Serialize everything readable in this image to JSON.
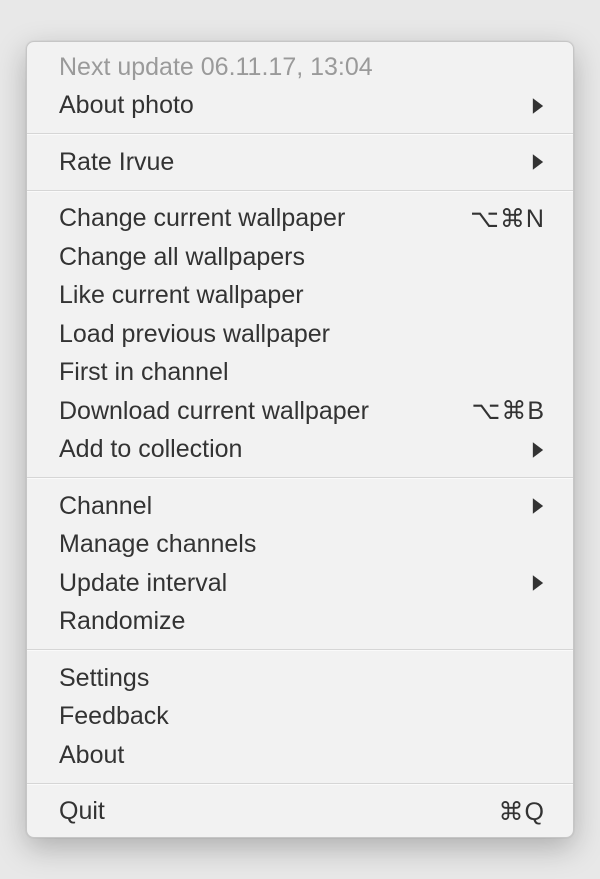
{
  "menu": {
    "next_update": "Next update 06.11.17, 13:04",
    "about_photo": "About photo",
    "rate_irvue": "Rate Irvue",
    "change_current": "Change current wallpaper",
    "change_current_shortcut": "⌥⌘N",
    "change_all": "Change all wallpapers",
    "like_current": "Like current wallpaper",
    "load_previous": "Load previous wallpaper",
    "first_in_channel": "First in channel",
    "download_current": "Download current wallpaper",
    "download_current_shortcut": "⌥⌘B",
    "add_to_collection": "Add to collection",
    "channel": "Channel",
    "manage_channels": "Manage channels",
    "update_interval": "Update interval",
    "randomize": "Randomize",
    "settings": "Settings",
    "feedback": "Feedback",
    "about": "About",
    "quit": "Quit",
    "quit_shortcut": "⌘Q"
  }
}
